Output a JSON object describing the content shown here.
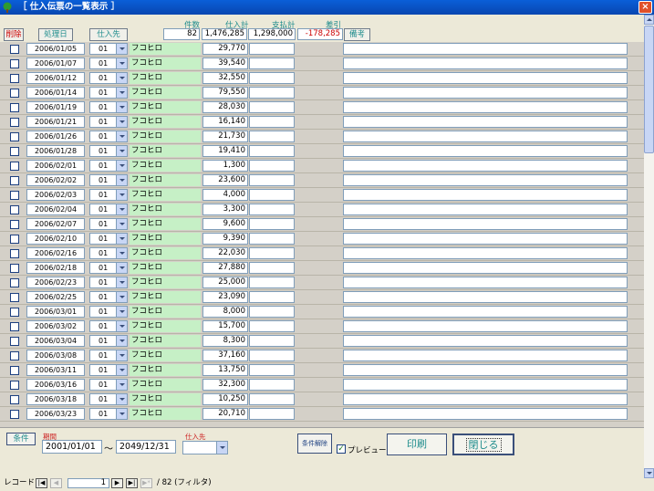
{
  "window": {
    "title": "［ 仕入伝票の一覧表示 ］",
    "close": "×"
  },
  "header": {
    "delete_label": "削除",
    "date_btn": "処理日",
    "supplier_btn": "仕入先",
    "count_label": "件数",
    "purchase_total_label": "仕入計",
    "payment_total_label": "支払計",
    "difference_label": "差引",
    "count": "82",
    "purchase_total": "1,476,285",
    "payment_total": "1,298,000",
    "difference": "-178,285",
    "notes_btn": "備考"
  },
  "rows": [
    {
      "date": "2006/01/05",
      "code": "01",
      "supplier": "フコヒロ",
      "amount": "29,770"
    },
    {
      "date": "2006/01/07",
      "code": "01",
      "supplier": "フコヒロ",
      "amount": "39,540"
    },
    {
      "date": "2006/01/12",
      "code": "01",
      "supplier": "フコヒロ",
      "amount": "32,550"
    },
    {
      "date": "2006/01/14",
      "code": "01",
      "supplier": "フコヒロ",
      "amount": "79,550"
    },
    {
      "date": "2006/01/19",
      "code": "01",
      "supplier": "フコヒロ",
      "amount": "28,030"
    },
    {
      "date": "2006/01/21",
      "code": "01",
      "supplier": "フコヒロ",
      "amount": "16,140"
    },
    {
      "date": "2006/01/26",
      "code": "01",
      "supplier": "フコヒロ",
      "amount": "21,730"
    },
    {
      "date": "2006/01/28",
      "code": "01",
      "supplier": "フコヒロ",
      "amount": "19,410"
    },
    {
      "date": "2006/02/01",
      "code": "01",
      "supplier": "フコヒロ",
      "amount": "1,300"
    },
    {
      "date": "2006/02/02",
      "code": "01",
      "supplier": "フコヒロ",
      "amount": "23,600"
    },
    {
      "date": "2006/02/03",
      "code": "01",
      "supplier": "フコヒロ",
      "amount": "4,000"
    },
    {
      "date": "2006/02/04",
      "code": "01",
      "supplier": "フコヒロ",
      "amount": "3,300"
    },
    {
      "date": "2006/02/07",
      "code": "01",
      "supplier": "フコヒロ",
      "amount": "9,600"
    },
    {
      "date": "2006/02/10",
      "code": "01",
      "supplier": "フコヒロ",
      "amount": "9,390"
    },
    {
      "date": "2006/02/16",
      "code": "01",
      "supplier": "フコヒロ",
      "amount": "22,030"
    },
    {
      "date": "2006/02/18",
      "code": "01",
      "supplier": "フコヒロ",
      "amount": "27,880"
    },
    {
      "date": "2006/02/23",
      "code": "01",
      "supplier": "フコヒロ",
      "amount": "25,000"
    },
    {
      "date": "2006/02/25",
      "code": "01",
      "supplier": "フコヒロ",
      "amount": "23,090"
    },
    {
      "date": "2006/03/01",
      "code": "01",
      "supplier": "フコヒロ",
      "amount": "8,000"
    },
    {
      "date": "2006/03/02",
      "code": "01",
      "supplier": "フコヒロ",
      "amount": "15,700"
    },
    {
      "date": "2006/03/04",
      "code": "01",
      "supplier": "フコヒロ",
      "amount": "8,300"
    },
    {
      "date": "2006/03/08",
      "code": "01",
      "supplier": "フコヒロ",
      "amount": "37,160"
    },
    {
      "date": "2006/03/11",
      "code": "01",
      "supplier": "フコヒロ",
      "amount": "13,750"
    },
    {
      "date": "2006/03/16",
      "code": "01",
      "supplier": "フコヒロ",
      "amount": "32,300"
    },
    {
      "date": "2006/03/18",
      "code": "01",
      "supplier": "フコヒロ",
      "amount": "10,250"
    },
    {
      "date": "2006/03/23",
      "code": "01",
      "supplier": "フコヒロ",
      "amount": "20,710"
    }
  ],
  "footer": {
    "condition_btn": "条件",
    "period_label": "期間",
    "date_from": "2001/01/01",
    "tilde": "～",
    "date_to": "2049/12/31",
    "supplier_label": "仕入先",
    "clear_btn": "条件解除",
    "preview_label": "プレビュー",
    "print_btn": "印刷",
    "close_btn": "閉じる"
  },
  "nav": {
    "record_label": "レコード:",
    "current": "1",
    "total_text": "/ 82 (フィルタ)",
    "first": "|◀",
    "prev": "◀",
    "next": "▶",
    "last": "▶|",
    "new": "▶*"
  },
  "colors": {
    "title_bar": "#0a5fd8",
    "teal_text": "#1e8c8c",
    "supplier_bg": "#c6f0c6",
    "negative": "#cc0000"
  }
}
